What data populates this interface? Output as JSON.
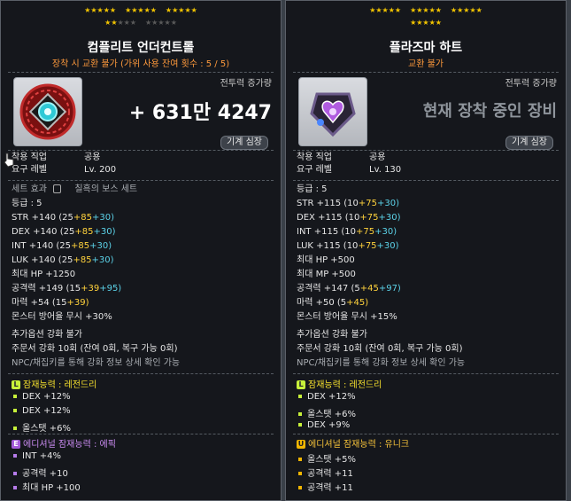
{
  "left": {
    "stars_row1": 15,
    "stars_row2_on": 2,
    "stars_row2_off": 8,
    "title": "컴플리트 언더컨트롤",
    "subtitle": "장착 시 교환 불가 (가위 사용 잔여 횟수 : 5 / 5)",
    "increase_label": "전투력 증가량",
    "increase_value": "+ 631만 4247",
    "mech_button": "기계 심장",
    "job_label": "착용 직업",
    "job_value": "공용",
    "level_label": "요구 레벨",
    "level_value": "Lv. 200",
    "set_effect_label": "세트 효과",
    "set_effect_value": "칠흑의 보스 세트",
    "grade": "등급 : 5",
    "stats": [
      {
        "name": "STR",
        "total": "+140",
        "base": "(25",
        "a": "+85",
        "b": "+30)"
      },
      {
        "name": "DEX",
        "total": "+140",
        "base": "(25",
        "a": "+85",
        "b": "+30)"
      },
      {
        "name": "INT",
        "total": "+140",
        "base": "(25",
        "a": "+85",
        "b": "+30)"
      },
      {
        "name": "LUK",
        "total": "+140",
        "base": "(25",
        "a": "+85",
        "b": "+30)"
      }
    ],
    "maxhp": "최대 HP   +1250",
    "atk": {
      "name": "공격력",
      "total": "+149",
      "base": "(15",
      "a": "+39",
      "b": "+95)"
    },
    "mag": {
      "name": "마력",
      "total": "+54",
      "base": "(15",
      "a": "+39)"
    },
    "ignore_def": "몬스터 방어율 무시   +30%",
    "extra_opt": "추가옵션 강화 불가",
    "scroll": "주문서 강화 10회 (잔여 0회, 복구 가능 0회)",
    "npc_hint": "NPC/채집키를 통해 강화 정보 상세 확인 가능",
    "potential_title": "잠재능력 : 레전드리",
    "potential": [
      "DEX +12%",
      "DEX +12%",
      "올스탯 +6%"
    ],
    "additional_title": "에디셔널 잠재능력 : 에픽",
    "additional": [
      "INT +4%",
      "공격력 +10",
      "최대 HP +100"
    ]
  },
  "right": {
    "stars_row1": 15,
    "stars_row2_on": 5,
    "title": "플라즈마 하트",
    "subtitle": "교환 불가",
    "increase_label": "전투력 증가량",
    "increase_text": "현재 장착 중인 장비",
    "mech_button": "기계 심장",
    "job_label": "착용 직업",
    "job_value": "공용",
    "level_label": "요구 레벨",
    "level_value": "Lv. 130",
    "grade": "등급 : 5",
    "stats": [
      {
        "name": "STR",
        "total": "+115",
        "base": "(10",
        "a": "+75",
        "b": "+30)"
      },
      {
        "name": "DEX",
        "total": "+115",
        "base": "(10",
        "a": "+75",
        "b": "+30)"
      },
      {
        "name": "INT",
        "total": "+115",
        "base": "(10",
        "a": "+75",
        "b": "+30)"
      },
      {
        "name": "LUK",
        "total": "+115",
        "base": "(10",
        "a": "+75",
        "b": "+30)"
      }
    ],
    "maxhp": "최대 HP   +500",
    "maxmp": "최대 MP   +500",
    "atk": {
      "name": "공격력",
      "total": "+147",
      "base": "(5",
      "a": "+45",
      "b": "+97)"
    },
    "mag": {
      "name": "마력",
      "total": "+50",
      "base": "(5",
      "a": "+45)"
    },
    "ignore_def": "몬스터 방어율 무시   +15%",
    "extra_opt": "추가옵션 강화 불가",
    "scroll": "주문서 강화 10회 (잔여 0회, 복구 가능 0회)",
    "npc_hint": "NPC/채집키를 통해 강화 정보 상세 확인 가능",
    "potential_title": "잠재능력 : 레전드리",
    "potential": [
      "DEX +12%",
      "올스탯 +6%",
      "DEX +9%"
    ],
    "additional_title": "에디셔널 잠재능력 : 유니크",
    "additional": [
      "올스탯 +5%",
      "공격력 +11",
      "공격력 +11"
    ]
  },
  "badges": {
    "legendary": "L",
    "epic": "E",
    "unique": "U"
  }
}
